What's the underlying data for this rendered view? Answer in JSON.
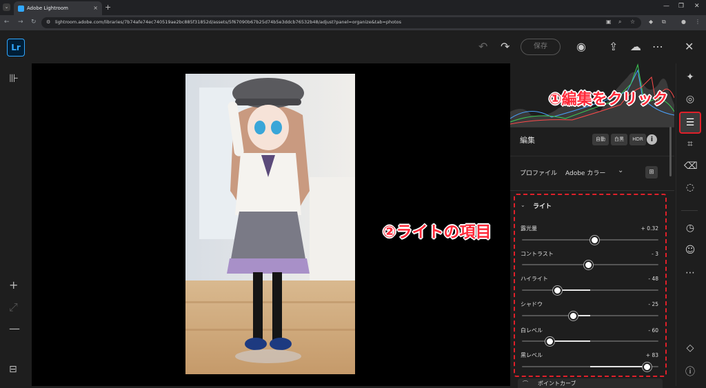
{
  "browser": {
    "tab_title": "Adobe Lightroom",
    "tab_close": "×",
    "new_tab": "+",
    "url": "lightroom.adobe.com/libraries/7b74afe74ec740519ae2bc885f31852d/assets/5f67090b67b25d74b5e3ddcb76532b48/adjust?panel=organize&tab=photos"
  },
  "app": {
    "logo": "Lr",
    "save_label": "保存"
  },
  "left_toolbar": {
    "zoom_in": "+",
    "zoom_out": "—"
  },
  "panel": {
    "edit_title": "編集",
    "auto_label": "自動",
    "bw_label": "白黒",
    "hdr_label": "HDR",
    "info_label": "i",
    "profile_label": "プロファイル",
    "profile_value": "Adobe カラー",
    "light_title": "ライト",
    "curve_label": "ポイントカーブ",
    "sliders": [
      {
        "label": "露光量",
        "value": "+ 0.32",
        "pos": 0.53
      },
      {
        "label": "コントラスト",
        "value": "- 3",
        "pos": 0.485
      },
      {
        "label": "ハイライト",
        "value": "- 48",
        "pos": 0.26
      },
      {
        "label": "シャドウ",
        "value": "- 25",
        "pos": 0.375
      },
      {
        "label": "白レベル",
        "value": "- 60",
        "pos": 0.2
      },
      {
        "label": "黒レベル",
        "value": "+ 83",
        "pos": 0.915
      }
    ]
  },
  "annotations": {
    "step1": "①編集をクリック",
    "step2": "②ライトの項目"
  }
}
